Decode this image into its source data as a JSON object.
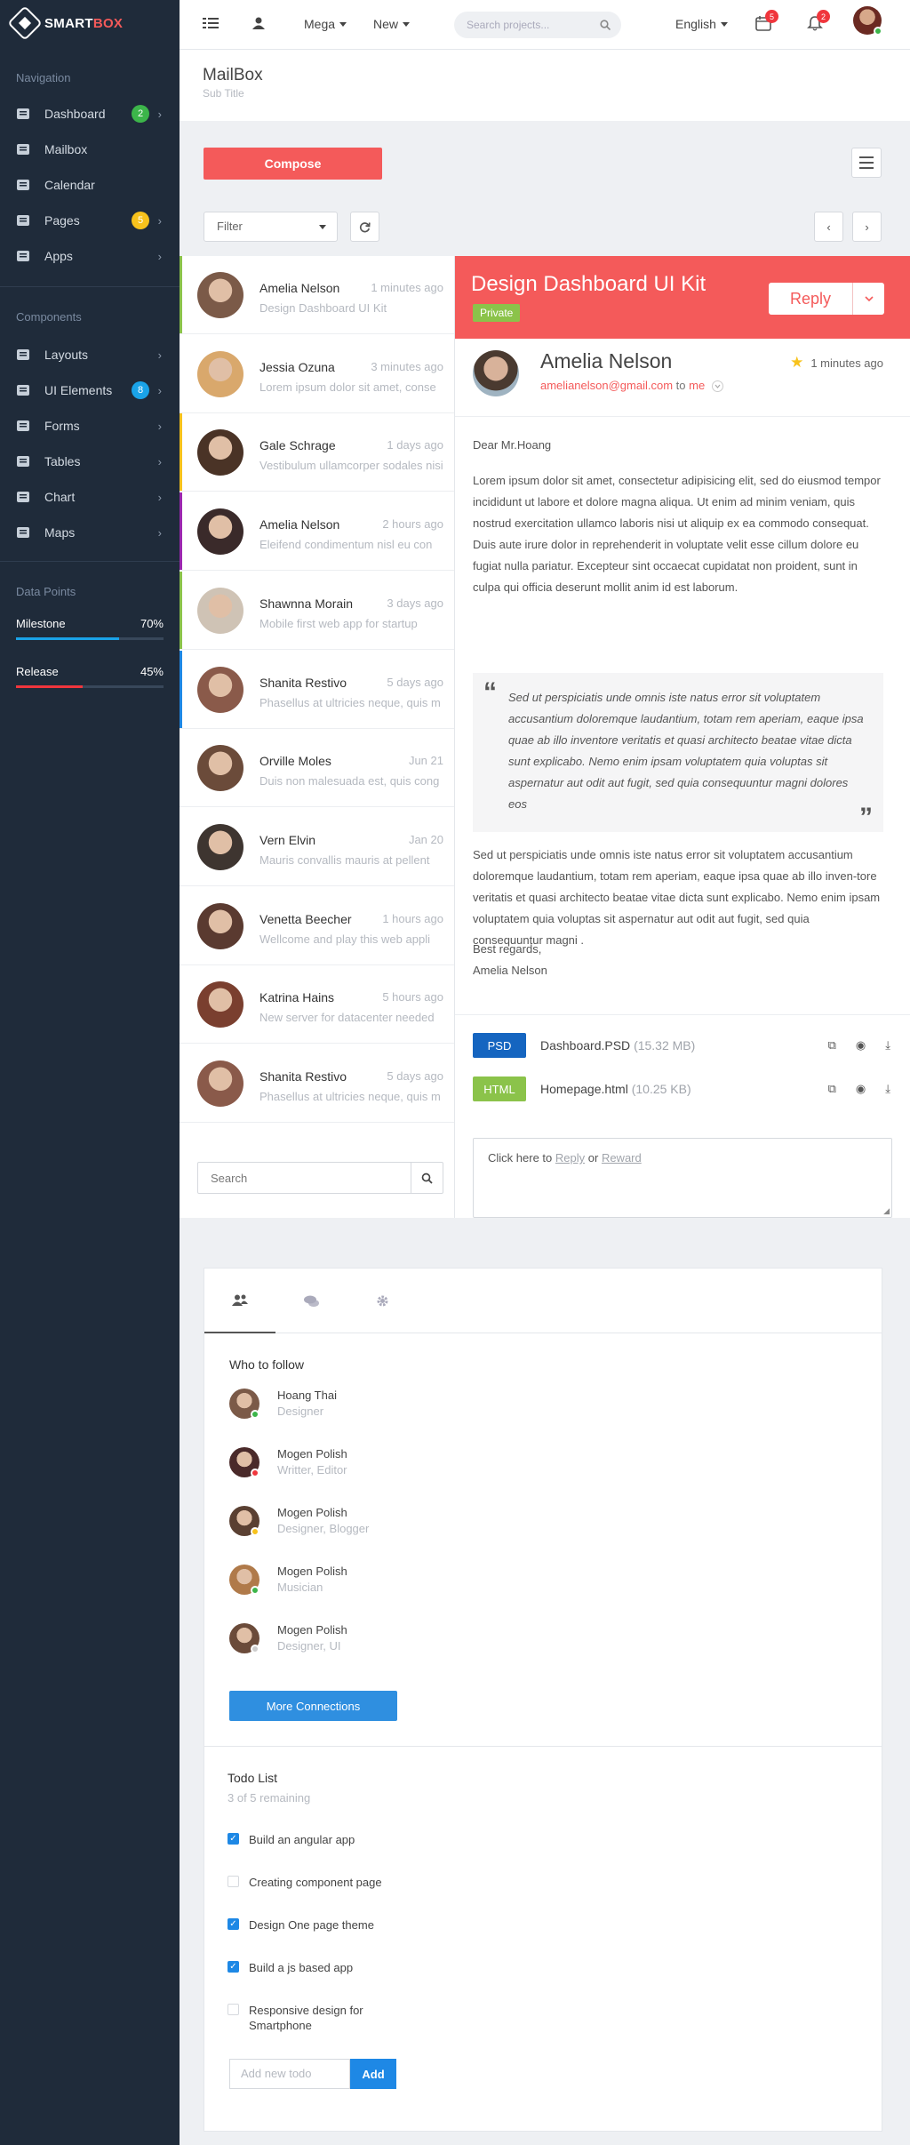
{
  "brand": {
    "name_a": "SMART",
    "name_b": "BOX"
  },
  "sidebar": {
    "nav_title": "Navigation",
    "nav_items": [
      {
        "label": "Dashboard",
        "icon": "dashboard-icon",
        "badge": "2",
        "badge_color": "#3cb54a",
        "chevron": true
      },
      {
        "label": "Mailbox",
        "icon": "envelope-icon"
      },
      {
        "label": "Calendar",
        "icon": "calendar-icon"
      },
      {
        "label": "Pages",
        "icon": "file-icon",
        "badge": "5",
        "badge_color": "#f7c21c",
        "chevron": true
      },
      {
        "label": "Apps",
        "icon": "briefcase-icon",
        "chevron": true
      }
    ],
    "comp_title": "Components",
    "comp_items": [
      {
        "label": "Layouts",
        "icon": "grid-icon",
        "chevron": true
      },
      {
        "label": "UI Elements",
        "icon": "suitcase-icon",
        "badge": "8",
        "badge_color": "#1aa3e8",
        "chevron": true
      },
      {
        "label": "Forms",
        "icon": "list-icon",
        "chevron": true
      },
      {
        "label": "Tables",
        "icon": "table-icon",
        "chevron": true
      },
      {
        "label": "Chart",
        "icon": "area-chart-icon",
        "chevron": true
      },
      {
        "label": "Maps",
        "icon": "map-icon",
        "chevron": true
      }
    ],
    "dp_title": "Data Points",
    "data_points": [
      {
        "label": "Milestone",
        "value": "70%",
        "fraction": 0.7,
        "color": "#1aa3e8"
      },
      {
        "label": "Release",
        "value": "45%",
        "fraction": 0.45,
        "color": "#f0363d"
      }
    ]
  },
  "topbar": {
    "mega": "Mega",
    "new": "New",
    "search_placeholder": "Search projects...",
    "language": "English",
    "calendar_count": "5",
    "notif_count": "2"
  },
  "page": {
    "title": "MailBox",
    "subtitle": "Sub Title"
  },
  "toolbar": {
    "compose": "Compose",
    "filter": "Filter"
  },
  "mails": [
    {
      "name": "Amelia Nelson",
      "time": "1 minutes ago",
      "preview": "Design Dashboard UI Kit",
      "strip": "#8bc34a",
      "avatar": "#7b5a48"
    },
    {
      "name": "Jessia Ozuna",
      "time": "3 minutes ago",
      "preview": "Lorem ipsum dolor sit amet, conse",
      "strip": "",
      "avatar": "#d9a86c"
    },
    {
      "name": "Gale Schrage",
      "time": "1 days ago",
      "preview": "Vestibulum ullamcorper sodales nisi",
      "strip": "#f7c21c",
      "avatar": "#4a3326"
    },
    {
      "name": "Amelia Nelson",
      "time": "2 hours ago",
      "preview": "Eleifend condimentum nisl eu con",
      "strip": "#9c27b0",
      "avatar": "#3a2a2a"
    },
    {
      "name": "Shawnna Morain",
      "time": "3 days ago",
      "preview": "Mobile first web app for startup",
      "strip": "#8bc34a",
      "avatar": "#cfc3b5"
    },
    {
      "name": "Shanita Restivo",
      "time": "5 days ago",
      "preview": "Phasellus at ultricies neque, quis m",
      "strip": "#1e88e5",
      "avatar": "#8a5a4a"
    },
    {
      "name": "Orville Moles",
      "time": "Jun 21",
      "preview": "Duis non malesuada est, quis cong",
      "strip": "",
      "avatar": "#6b4b3a"
    },
    {
      "name": "Vern Elvin",
      "time": "Jan 20",
      "preview": "Mauris convallis mauris at pellent",
      "strip": "",
      "avatar": "#3e3530"
    },
    {
      "name": "Venetta Beecher",
      "time": "1 hours ago",
      "preview": "Wellcome and play this web appli",
      "strip": "",
      "avatar": "#5a3a30"
    },
    {
      "name": "Katrina Hains",
      "time": "5 hours ago",
      "preview": "New server for datacenter needed",
      "strip": "",
      "avatar": "#7a3f2f"
    },
    {
      "name": "Shanita Restivo",
      "time": "5 days ago",
      "preview": "Phasellus at ultricies neque, quis m",
      "strip": "",
      "avatar": "#8a5a4a"
    }
  ],
  "list_search_placeholder": "Search",
  "message": {
    "subject": "Design Dashboard UI Kit",
    "tag": "Private",
    "reply": "Reply",
    "sender_name": "Amelia Nelson",
    "sender_email": "amelianelson@gmail.com",
    "to_word": "to",
    "me_word": "me",
    "time": "1 minutes ago",
    "greeting": "Dear Mr.Hoang",
    "para1": "Lorem ipsum dolor sit amet, consectetur adipisicing elit, sed do eiusmod tempor incididunt ut labore et dolore magna aliqua. Ut enim ad minim veniam, quis nostrud exercitation ullamco laboris nisi ut aliquip ex ea commodo consequat. Duis aute irure dolor in reprehenderit in voluptate velit esse cillum dolore eu fugiat nulla pariatur. Excepteur sint occaecat cupidatat non proident, sunt in culpa qui officia deserunt mollit anim id est laborum.",
    "quote": "Sed ut perspiciatis unde omnis iste natus error sit voluptatem accusantium doloremque laudantium, totam rem aperiam, eaque ipsa quae ab illo inventore veritatis et quasi architecto beatae vitae dicta sunt explicabo. Nemo enim ipsam voluptatem quia voluptas sit aspernatur aut odit aut fugit, sed quia consequuntur magni dolores eos",
    "para2": "Sed ut perspiciatis unde omnis iste natus error sit voluptatem accusantium doloremque laudantium, totam rem aperiam, eaque ipsa quae ab illo inven-tore veritatis et quasi architecto beatae vitae dicta sunt explicabo. Nemo enim ipsam voluptatem quia voluptas sit aspernatur aut odit aut fugit, sed quia consequuntur magni .",
    "regards": "Best regards,",
    "signature": "Amelia Nelson",
    "attachments": [
      {
        "type": "PSD",
        "color": "#1565c0",
        "name": "Dashboard.PSD",
        "size": "(15.32 MB)"
      },
      {
        "type": "HTML",
        "color": "#8bc34a",
        "name": "Homepage.html",
        "size": "(10.25 KB)"
      }
    ],
    "reply_prompt": "Click here to",
    "reply_link": "Reply",
    "or_word": "or",
    "reward_link": "Reward"
  },
  "follow": {
    "title": "Who to follow",
    "people": [
      {
        "name": "Hoang Thai",
        "role": "Designer",
        "status": "#3cb54a",
        "avatar": "#7b5a48"
      },
      {
        "name": "Mogen Polish",
        "role": "Writter, Editor",
        "status": "#f0363d",
        "avatar": "#4a2a2a"
      },
      {
        "name": "Mogen Polish",
        "role": "Designer, Blogger",
        "status": "#f7c21c",
        "avatar": "#5a4032"
      },
      {
        "name": "Mogen Polish",
        "role": "Musician",
        "status": "#3cb54a",
        "avatar": "#b07a4a"
      },
      {
        "name": "Mogen Polish",
        "role": "Designer, UI",
        "status": "#cccccc",
        "avatar": "#6b4b3a"
      }
    ],
    "more": "More Connections"
  },
  "todo": {
    "title": "Todo List",
    "remaining": "3 of 5 remaining",
    "items": [
      {
        "text": "Build an angular app",
        "done": true
      },
      {
        "text": "Creating component page",
        "done": false
      },
      {
        "text": "Design One page theme",
        "done": true
      },
      {
        "text": "Build a js based app",
        "done": true
      },
      {
        "text": "Responsive design for Smartphone",
        "done": false
      }
    ],
    "input_placeholder": "Add new todo",
    "add": "Add"
  }
}
